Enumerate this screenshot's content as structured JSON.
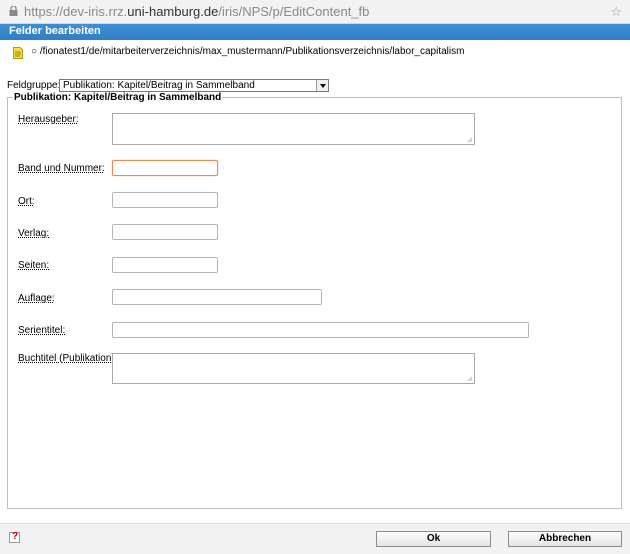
{
  "browser": {
    "url_prefix": "https://dev-iris.rrz.",
    "url_host": "uni-hamburg.de",
    "url_path": "/iris/NPS/p/EditContent_fb"
  },
  "dialog": {
    "title": "Felder bearbeiten",
    "path": "○ /fionatest1/de/mitarbeiterverzeichnis/max_mustermann/Publikationsverzeichnis/labor_capitalism",
    "fieldgroup_label": "Feldgruppe:",
    "fieldgroup_value": "Publikation: Kapitel/Beitrag in Sammelband",
    "group_legend": "Publikation: Kapitel/Beitrag in Sammelband"
  },
  "fields": {
    "herausgeber": {
      "label": "Herausgeber:",
      "value": ""
    },
    "band": {
      "label": "Band und Nummer:",
      "value": ""
    },
    "ort": {
      "label": "Ort:",
      "value": ""
    },
    "verlag": {
      "label": "Verlag:",
      "value": ""
    },
    "seiten": {
      "label": "Seiten:",
      "value": ""
    },
    "auflage": {
      "label": "Auflage:",
      "value": ""
    },
    "serientitel": {
      "label": "Serientitel:",
      "value": ""
    },
    "buchtitel": {
      "label": "Buchtitel (Publikation):",
      "value": ""
    }
  },
  "footer": {
    "help_glyph": "?",
    "ok_label": "Ok",
    "cancel_label": "Abbrechen"
  },
  "colors": {
    "titlebar": "#2f7ec7",
    "focus_border": "#e08a5a"
  }
}
